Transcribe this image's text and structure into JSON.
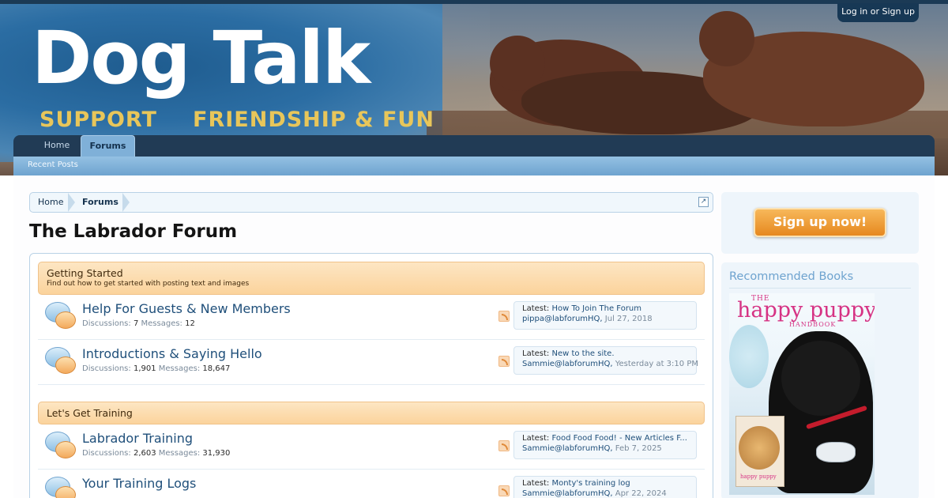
{
  "header": {
    "logo_title": "Dog Talk",
    "logo_tagline_1": "SUPPORT",
    "logo_tagline_2": "FRIENDSHIP & FUN",
    "login_label": "Log in or Sign up"
  },
  "nav": {
    "tabs": [
      {
        "label": "Home",
        "active": false
      },
      {
        "label": "Forums",
        "active": true
      }
    ],
    "subnav": [
      "Recent Posts"
    ]
  },
  "breadcrumb": [
    "Home",
    "Forums"
  ],
  "page_title": "The Labrador Forum",
  "categories": [
    {
      "title": "Getting Started",
      "description": "Find out how to get started with posting text and images",
      "forums": [
        {
          "title": "Help For Guests & New Members",
          "discussions_label": "Discussions:",
          "discussions": "7",
          "messages_label": "Messages:",
          "messages": "12",
          "latest_label": "Latest:",
          "latest_title": "How To Join The Forum",
          "latest_user": "pippa@labforumHQ,",
          "latest_date": "Jul 27, 2018"
        },
        {
          "title": "Introductions & Saying Hello",
          "discussions_label": "Discussions:",
          "discussions": "1,901",
          "messages_label": "Messages:",
          "messages": "18,647",
          "latest_label": "Latest:",
          "latest_title": "New to the site.",
          "latest_user": "Sammie@labforumHQ,",
          "latest_date": "Yesterday at 3:10 PM"
        }
      ]
    },
    {
      "title": "Let's Get Training",
      "description": "",
      "forums": [
        {
          "title": "Labrador Training",
          "discussions_label": "Discussions:",
          "discussions": "2,603",
          "messages_label": "Messages:",
          "messages": "31,930",
          "latest_label": "Latest:",
          "latest_title": "Food Food Food! - New Articles F...",
          "latest_user": "Sammie@labforumHQ,",
          "latest_date": "Feb 7, 2025"
        },
        {
          "title": "Your Training Logs",
          "discussions_label": "",
          "discussions": "",
          "messages_label": "",
          "messages": "",
          "latest_label": "Latest:",
          "latest_title": "Monty's training log",
          "latest_user": "Sammie@labforumHQ,",
          "latest_date": "Apr 22, 2024"
        }
      ]
    }
  ],
  "sidebar": {
    "signup_label": "Sign up now!",
    "books_heading": "Recommended Books",
    "book": {
      "the": "THE",
      "title": "happy puppy",
      "subtitle": "HANDBOOK",
      "inset_title": "happy puppy"
    }
  },
  "colors": {
    "nav_bg": "#213b55",
    "accent_blue": "#1f4f7a",
    "category_orange": "#fbd39c",
    "signup_orange": "#e6881f",
    "logo_gold": "#e8c65a"
  },
  "icons": {
    "forum_node": "speech-bubbles-icon",
    "feed": "rss-feed-icon",
    "jump": "jump-to-page-icon"
  }
}
